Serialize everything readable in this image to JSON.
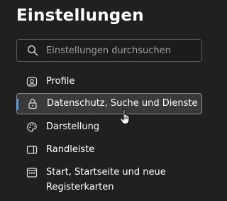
{
  "header": {
    "title": "Einstellungen"
  },
  "search": {
    "placeholder": "Einstellungen durchsuchen"
  },
  "sidebar": {
    "items": [
      {
        "label": "Profile",
        "icon": "profile-icon",
        "selected": false
      },
      {
        "label": "Datenschutz, Suche und Dienste",
        "icon": "lock-icon",
        "selected": true
      },
      {
        "label": "Darstellung",
        "icon": "palette-icon",
        "selected": false
      },
      {
        "label": "Randleiste",
        "icon": "sidebar-icon",
        "selected": false
      },
      {
        "label_line1": "Start, Startseite und neue",
        "label_line2": "Registerkarten",
        "icon": "home-tabs-icon",
        "selected": false
      }
    ]
  },
  "colors": {
    "background": "#202020",
    "selected_background": "#3a3a3a",
    "accent": "#5aa0e6"
  }
}
